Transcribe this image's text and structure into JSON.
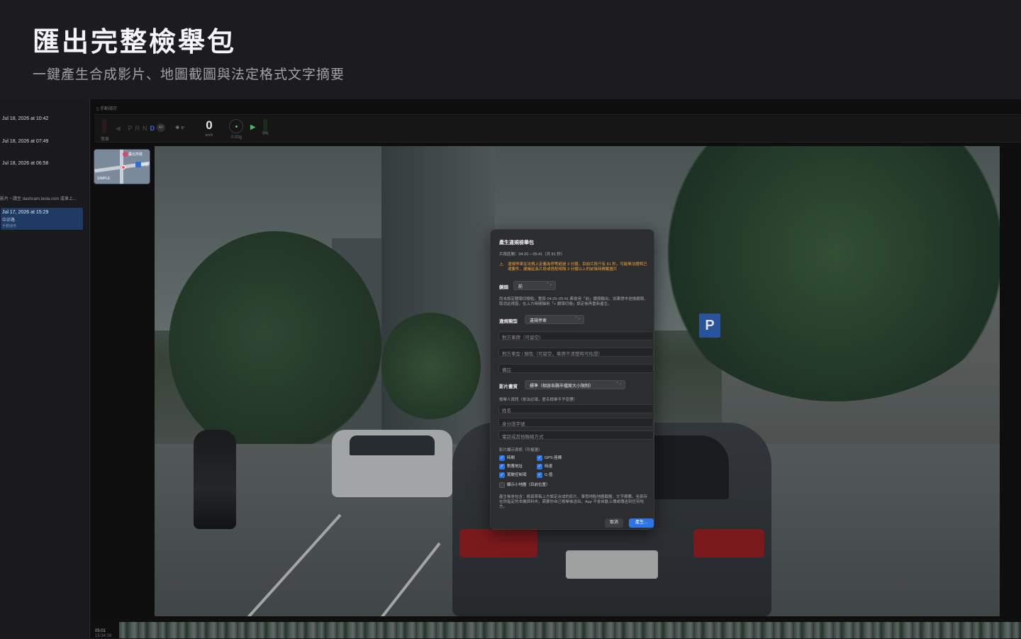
{
  "hero": {
    "title": "匯出完整檢舉包",
    "subtitle": "一鍵產生合成影片、地圖截圖與法定格式文字摘要"
  },
  "sidebar": {
    "entries": [
      {
        "label": "Jul 18, 2026 at 10:42"
      },
      {
        "label": "Jul 18, 2026 at 07:49"
      },
      {
        "label": "Jul 18, 2026 at 06:58"
      }
    ],
    "note": "影片・請至 dashcam.tesla.com 或車上...",
    "active": {
      "date": "Jul 17, 2026 at 15:29",
      "location": "中正路",
      "tag": "手動儲存"
    }
  },
  "main": {
    "crumb": "手動儲存",
    "hud": {
      "brake_label": "煞車",
      "gear": [
        "P",
        "R",
        "N",
        "D"
      ],
      "gear_active": "D",
      "ap": "AP",
      "steer": "5°",
      "speed": "0",
      "speed_unit": "km/h",
      "gforce": "0.00g",
      "throttle": "0%"
    },
    "minimap": {
      "label_top": "臺北市政",
      "label_right": "財務",
      "label_left": "SIMPLE"
    }
  },
  "dialog": {
    "title": "產生違規檢舉包",
    "range": "片段區間：04:20 – 05:41（共 81 秒）",
    "warning": "違規停車在法規上定義為停等超過 3 分鐘，目前片段只有 81 秒，可能無法證明已達要件，建議延長片段或搭配相隔 3 分鐘以上的前後時間截圖片",
    "camera_label": "鏡頭",
    "camera_value": "前",
    "camera_help": "尚未設定鏡頭切換點，整段 04:20–05:41 都會用「前」鏡頭輸出。如果想中途換鏡頭，取消此視窗，在上方時間軸用「+ 鏡頭切換」設定後再重新產生。",
    "type_label": "違規類型",
    "type_value": "違規停車",
    "plate_placeholder": "對方車牌（可留空）",
    "model_placeholder": "對方車型 / 顏色（可留空，車牌不清楚時可佐證）",
    "note_placeholder": "備註",
    "quality_label": "影片畫質",
    "quality_value": "標準（相容各縣市檔案大小限制）",
    "reporter_label": "檢舉人資訊（依法必填，匿名檢舉不予受理）",
    "name_placeholder": "姓名",
    "id_placeholder": "身分證字號",
    "contact_placeholder": "電話或其他聯絡方式",
    "overlay_label": "影片顯示資訊（可複選）",
    "checks": [
      {
        "label": "時間",
        "checked": true
      },
      {
        "label": "GPS 座標",
        "checked": true
      },
      {
        "label": "對應地址",
        "checked": true
      },
      {
        "label": "時速",
        "checked": true
      },
      {
        "label": "駕駛控制項",
        "checked": true
      },
      {
        "label": "G 值",
        "checked": true
      },
      {
        "label": "顯示小地圖（目前位置）",
        "checked": false
      }
    ],
    "footer": "產生後會包含：條頁首稿上方設定合成的影片、事發地點地圖截圖、文字摘要。全部存在你指定的本機資料夾，需要你自己檢舉後送出，App 不會自動上傳或傳送到任何地方。",
    "cancel": "取消",
    "confirm": "產生..."
  },
  "timeline": {
    "time1": "05:01",
    "time2": "15:34:39"
  }
}
